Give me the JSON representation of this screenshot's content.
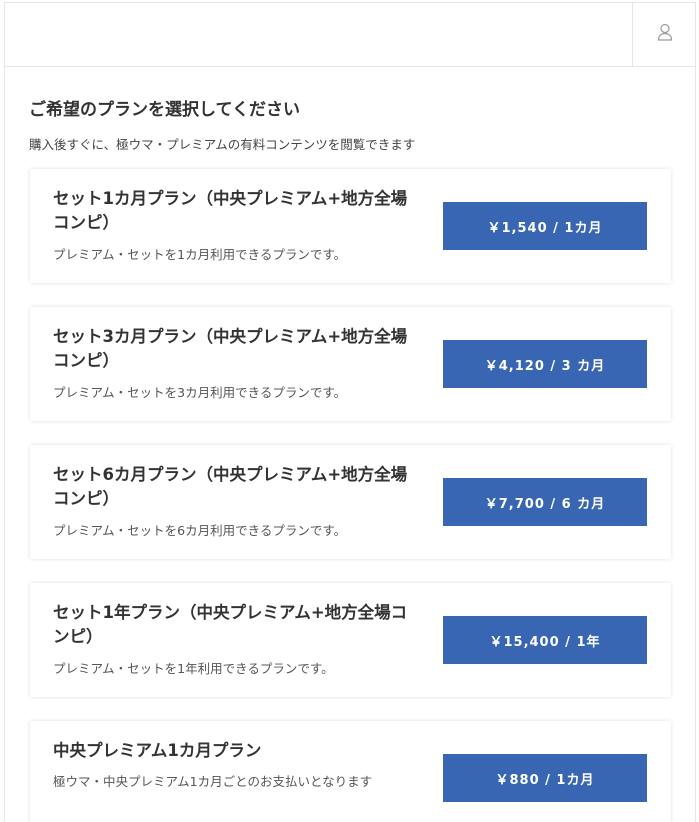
{
  "header": {
    "user_icon": "user-icon"
  },
  "page": {
    "title": "ご希望のプランを選択してください",
    "subtitle": "購入後すぐに、極ウマ・プレミアムの有料コンテンツを閲覧できます"
  },
  "plans": [
    {
      "name": "セット1カ月プラン（中央プレミアム+地方全場コンピ）",
      "desc": "プレミアム・セットを1カ月利用できるプランです。",
      "price": "￥1,540 / 1カ月"
    },
    {
      "name": "セット3カ月プラン（中央プレミアム+地方全場コンピ）",
      "desc": "プレミアム・セットを3カ月利用できるプランです。",
      "price": "￥4,120 / 3 カ月"
    },
    {
      "name": "セット6カ月プラン（中央プレミアム+地方全場コンピ）",
      "desc": "プレミアム・セットを6カ月利用できるプランです。",
      "price": "￥7,700 / 6 カ月"
    },
    {
      "name": "セット1年プラン（中央プレミアム+地方全場コンピ）",
      "desc": "プレミアム・セットを1年利用できるプランです。",
      "price": "￥15,400 / 1年"
    },
    {
      "name": "中央プレミアム1カ月プラン",
      "desc": "極ウマ・中央プレミアム1カ月ごとのお支払いとなります",
      "price": "￥880 / 1カ月"
    }
  ],
  "colors": {
    "accent": "#3966b3",
    "border": "#e6e6e6"
  }
}
